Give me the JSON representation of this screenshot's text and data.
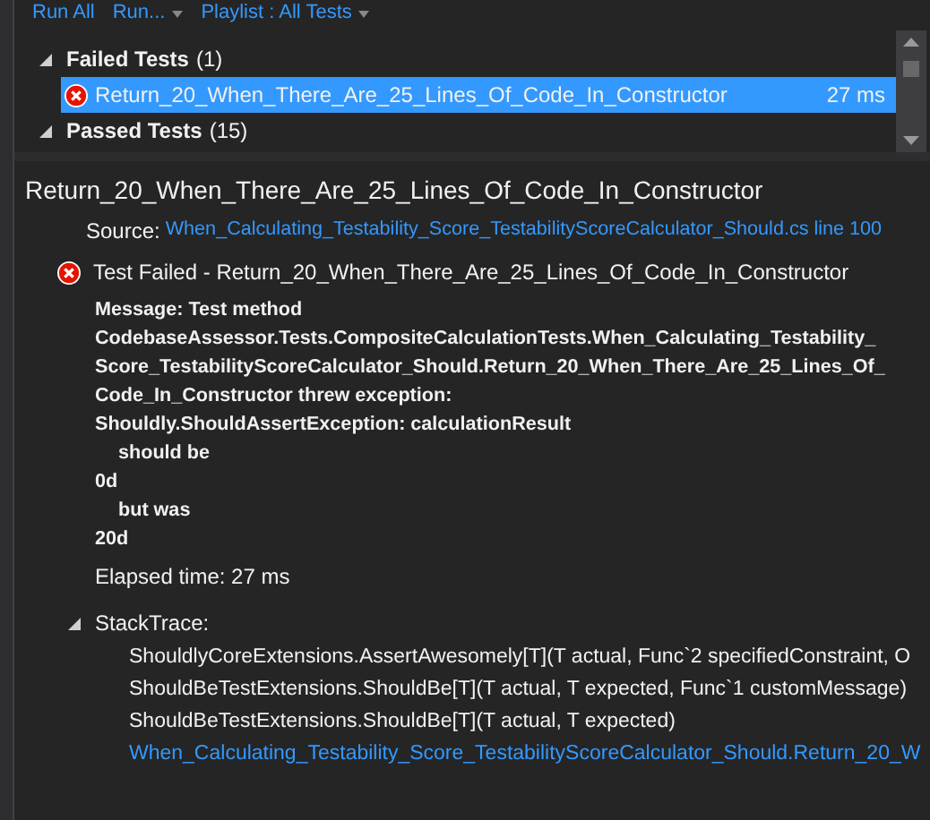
{
  "toolbar": {
    "items": [
      {
        "label": "Run All",
        "kind": "link"
      },
      {
        "label": "Run...",
        "kind": "dropdown"
      },
      {
        "label": "Playlist : All Tests",
        "kind": "dropdown"
      }
    ]
  },
  "test_groups": [
    {
      "title": "Failed Tests",
      "count": "(1)",
      "expanded": true,
      "tests": [
        {
          "name": "Return_20_When_There_Are_25_Lines_Of_Code_In_Constructor",
          "duration": "27 ms",
          "selected": true
        }
      ]
    },
    {
      "title": "Passed Tests",
      "count": "(15)",
      "expanded": true
    }
  ],
  "details": {
    "title": "Return_20_When_There_Are_25_Lines_Of_Code_In_Constructor",
    "source_label": "Source:",
    "source_link": "When_Calculating_Testability_Score_TestabilityScoreCalculator_Should.cs line 100",
    "result": "Test Failed - Return_20_When_There_Are_25_Lines_Of_Code_In_Constructor",
    "message_lines": [
      {
        "text": "Message: Test method",
        "indented": false
      },
      {
        "text": "CodebaseAssessor.Tests.CompositeCalculationTests.When_Calculating_Testability_",
        "indented": false
      },
      {
        "text": "Score_TestabilityScoreCalculator_Should.Return_20_When_There_Are_25_Lines_Of_",
        "indented": false
      },
      {
        "text": "Code_In_Constructor threw exception:",
        "indented": false
      },
      {
        "text": "Shouldly.ShouldAssertException: calculationResult",
        "indented": false
      },
      {
        "text": "should be",
        "indented": true
      },
      {
        "text": "0d",
        "indented": false
      },
      {
        "text": "but was",
        "indented": true
      },
      {
        "text": "20d",
        "indented": false
      }
    ],
    "elapsed": "Elapsed time: 27 ms",
    "stack_label": "StackTrace:",
    "stack_expanded": true,
    "stack": [
      {
        "text": "ShouldlyCoreExtensions.AssertAwesomely[T](T actual, Func`2 specifiedConstraint, O",
        "kind": "text"
      },
      {
        "text": "ShouldBeTestExtensions.ShouldBe[T](T actual, T expected, Func`1 customMessage)",
        "kind": "text"
      },
      {
        "text": "ShouldBeTestExtensions.ShouldBe[T](T actual, T expected)",
        "kind": "text"
      },
      {
        "text": "When_Calculating_Testability_Score_TestabilityScoreCalculator_Should.Return_20_W",
        "kind": "link"
      }
    ]
  }
}
